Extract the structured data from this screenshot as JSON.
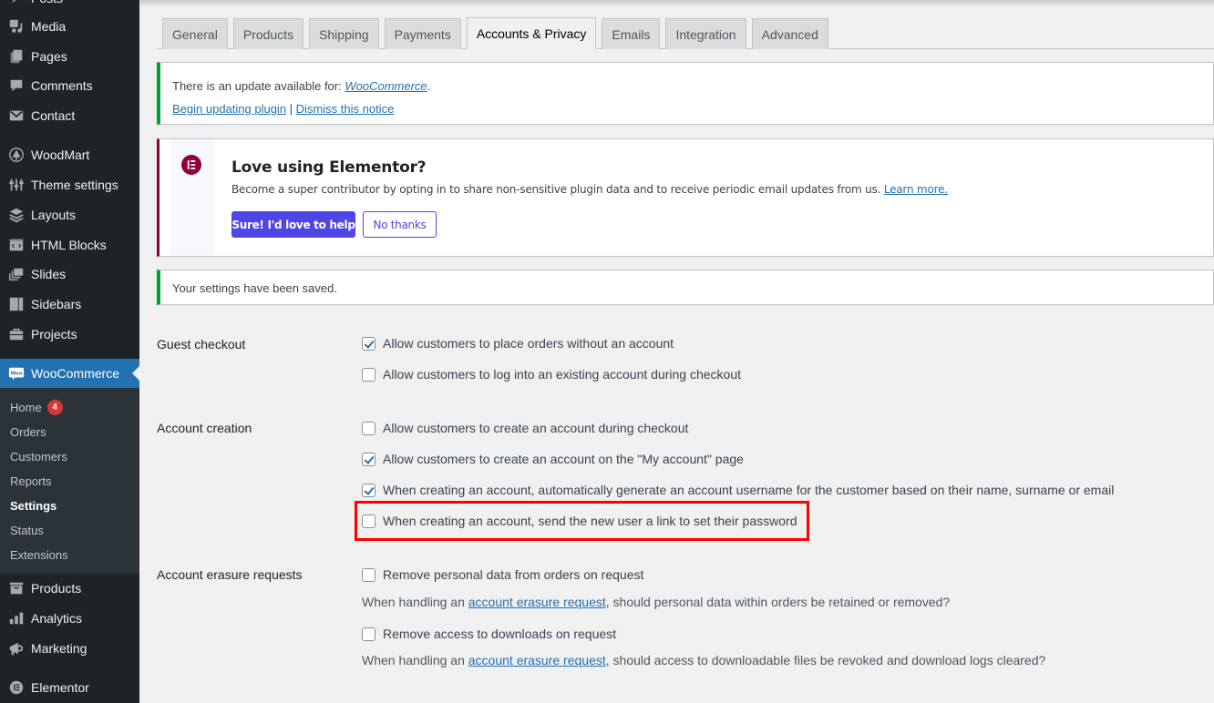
{
  "sidebar": {
    "top_partial": "Posts",
    "items": [
      {
        "label": "Media",
        "icon": "media-icon"
      },
      {
        "label": "Pages",
        "icon": "pages-icon"
      },
      {
        "label": "Comments",
        "icon": "comments-icon"
      },
      {
        "label": "Contact",
        "icon": "envelope-icon"
      },
      {
        "label": "WoodMart",
        "icon": "woodmart-icon"
      },
      {
        "label": "Theme settings",
        "icon": "sliders-icon"
      },
      {
        "label": "Layouts",
        "icon": "layers-icon"
      },
      {
        "label": "HTML Blocks",
        "icon": "code-block-icon"
      },
      {
        "label": "Slides",
        "icon": "slides-icon"
      },
      {
        "label": "Sidebars",
        "icon": "sidebars-icon"
      },
      {
        "label": "Projects",
        "icon": "briefcase-icon"
      },
      {
        "label": "WooCommerce",
        "icon": "woo-icon",
        "active": true
      },
      {
        "label": "Products",
        "icon": "archive-box-icon"
      },
      {
        "label": "Analytics",
        "icon": "bar-chart-icon"
      },
      {
        "label": "Marketing",
        "icon": "megaphone-icon"
      },
      {
        "label": "Elementor",
        "icon": "elementor-icon"
      }
    ],
    "woo_logo_text": "Woo",
    "submenu": [
      {
        "label": "Home",
        "badge": "4"
      },
      {
        "label": "Orders"
      },
      {
        "label": "Customers"
      },
      {
        "label": "Reports"
      },
      {
        "label": "Settings",
        "current": true
      },
      {
        "label": "Status"
      },
      {
        "label": "Extensions"
      }
    ]
  },
  "tabs": [
    {
      "label": "General"
    },
    {
      "label": "Products"
    },
    {
      "label": "Shipping"
    },
    {
      "label": "Payments"
    },
    {
      "label": "Accounts & Privacy",
      "active": true
    },
    {
      "label": "Emails"
    },
    {
      "label": "Integration"
    },
    {
      "label": "Advanced"
    }
  ],
  "update_notice": {
    "text_prefix": "There is an update available for: ",
    "plugin_link": "WooCommerce",
    "text_suffix": ".",
    "begin_link": "Begin updating plugin",
    "separator": " | ",
    "dismiss_link": "Dismiss this notice"
  },
  "elementor_notice": {
    "title": "Love using Elementor?",
    "text": "Become a super contributor by opting in to share non-sensitive plugin data and to receive periodic email updates from us. ",
    "learn_more": "Learn more.",
    "primary_button": "Sure! I'd love to help",
    "secondary_button": "No thanks",
    "brand_color": "#92003b",
    "button_color": "#5046e5"
  },
  "saved_notice": {
    "text": "Your settings have been saved."
  },
  "settings": {
    "guest_checkout": {
      "label": "Guest checkout",
      "options": [
        {
          "label": "Allow customers to place orders without an account",
          "checked": true
        },
        {
          "label": "Allow customers to log into an existing account during checkout",
          "checked": false
        }
      ]
    },
    "account_creation": {
      "label": "Account creation",
      "options": [
        {
          "label": "Allow customers to create an account during checkout",
          "checked": false
        },
        {
          "label": "Allow customers to create an account on the \"My account\" page",
          "checked": true
        },
        {
          "label": "When creating an account, automatically generate an account username for the customer based on their name, surname or email",
          "checked": true
        },
        {
          "label": "When creating an account, send the new user a link to set their password",
          "checked": false,
          "highlighted": true
        }
      ]
    },
    "account_erasure": {
      "label": "Account erasure requests",
      "options": [
        {
          "label": "Remove personal data from orders on request",
          "checked": false,
          "desc_prefix": "When handling an ",
          "desc_link": "account erasure request",
          "desc_suffix": ", should personal data within orders be retained or removed?"
        },
        {
          "label": "Remove access to downloads on request",
          "checked": false,
          "desc_prefix": "When handling an ",
          "desc_link": "account erasure request",
          "desc_suffix": ", should access to downloadable files be revoked and download logs cleared?"
        }
      ]
    }
  },
  "colors": {
    "sidebar_bg": "#1d2327",
    "active_menu": "#2271b1",
    "link": "#2271b1",
    "success_border": "#00a32a",
    "highlight_box": "#ff0000",
    "badge": "#d63638"
  }
}
